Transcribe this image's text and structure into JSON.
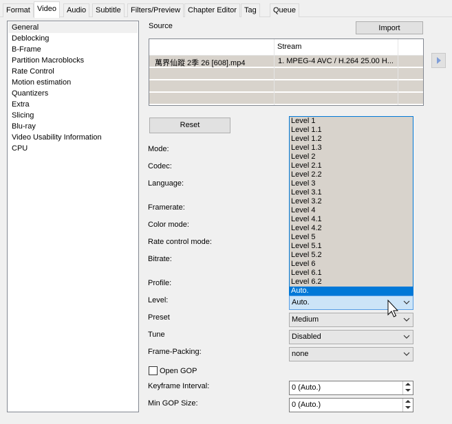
{
  "tabs": [
    "Format",
    "Video",
    "Audio",
    "Subtitle",
    "Filters/Preview",
    "Chapter Editor",
    "Tag",
    "Queue"
  ],
  "active_tab": "Video",
  "nav": {
    "items": [
      "General",
      "Deblocking",
      "B-Frame",
      "Partition Macroblocks",
      "Rate Control",
      "Motion estimation",
      "Quantizers",
      "Extra",
      "Slicing",
      "Blu-ray",
      "Video Usability Information",
      "CPU"
    ],
    "selected": "General"
  },
  "source": {
    "label": "Source",
    "import_label": "Import",
    "columns": [
      "",
      "Stream"
    ],
    "rows": [
      {
        "file": "萬界仙蹤 2季 26 [608].mp4",
        "stream": "1. MPEG-4 AVC / H.264 25.00 H..."
      }
    ]
  },
  "reset_label": "Reset",
  "fields": {
    "mode": "Mode:",
    "codec": "Codec:",
    "language": "Language:",
    "framerate": "Framerate:",
    "color_mode": "Color mode:",
    "rate_control_mode": "Rate control mode:",
    "bitrate": "Bitrate:",
    "profile": "Profile:",
    "level": "Level:",
    "preset": "Preset",
    "tune": "Tune",
    "frame_packing": "Frame-Packing:",
    "open_gop": "Open GOP",
    "keyframe_interval": "Keyframe Interval:",
    "min_gop_size": "Min GOP Size:"
  },
  "values": {
    "level": "Auto.",
    "preset": "Medium",
    "tune": "Disabled",
    "frame_packing": "none",
    "keyframe_interval": "0 (Auto.)",
    "min_gop_size": "0 (Auto.)",
    "open_gop_checked": false
  },
  "level_dropdown": {
    "options": [
      "Level 1",
      "Level 1.1",
      "Level 1.2",
      "Level 1.3",
      "Level 2",
      "Level 2.1",
      "Level 2.2",
      "Level 3",
      "Level 3.1",
      "Level 3.2",
      "Level 4",
      "Level 4.1",
      "Level 4.2",
      "Level 5",
      "Level 5.1",
      "Level 5.2",
      "Level 6",
      "Level 6.1",
      "Level 6.2",
      "Auto."
    ],
    "highlighted": "Auto."
  },
  "colors": {
    "accent": "#0078d7",
    "focus_fill": "#cce4f7",
    "list_bg": "#d8d3cc"
  }
}
